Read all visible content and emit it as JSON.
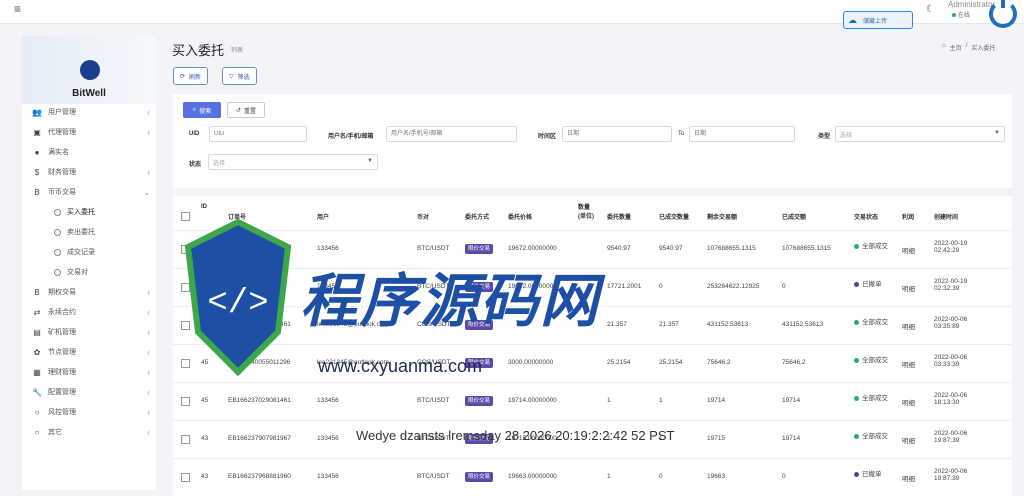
{
  "topbar": {
    "top_button_label": "储藏上传",
    "admin_name": "Administrator",
    "status_label": "在线"
  },
  "sidebar": {
    "brand": "BitWell",
    "items": [
      {
        "label": "用户管理",
        "icon": "users-icon",
        "chevron": "‹"
      },
      {
        "label": "代理管理",
        "icon": "idcard-icon",
        "chevron": "‹"
      },
      {
        "label": "满实名",
        "icon": "user-circle-icon",
        "chevron": ""
      },
      {
        "label": "财务管理",
        "icon": "dollar-icon",
        "chevron": "‹"
      },
      {
        "label": "币币交易",
        "icon": "bitcoin-icon",
        "chevron": "⌄"
      }
    ],
    "sub_items": [
      {
        "label": "买入委托"
      },
      {
        "label": "卖出委托"
      },
      {
        "label": "成交记录"
      },
      {
        "label": "交易对"
      }
    ],
    "items_after": [
      {
        "label": "期权交易",
        "icon": "bitcoin-icon",
        "chevron": "‹"
      },
      {
        "label": "永续合约",
        "icon": "swap-icon",
        "chevron": "‹"
      },
      {
        "label": "矿机管理",
        "icon": "image-icon",
        "chevron": "‹"
      },
      {
        "label": "节点管理",
        "icon": "gear-icon",
        "chevron": "‹"
      },
      {
        "label": "理财管理",
        "icon": "grid-icon",
        "chevron": "‹"
      },
      {
        "label": "配置管理",
        "icon": "wrench-icon",
        "chevron": "‹"
      },
      {
        "label": "风控管理",
        "icon": "circle-icon",
        "chevron": "‹"
      },
      {
        "label": "其它",
        "icon": "circle-icon",
        "chevron": "‹"
      }
    ]
  },
  "page": {
    "title": "买入委托",
    "subtitle": "列表",
    "breadcrumb_home": "主页",
    "breadcrumb_sep": "/",
    "breadcrumb_current": "买入委托",
    "refresh_label": "刷新",
    "filter_label": "筛选"
  },
  "filters": {
    "search_label": "搜索",
    "reset_label": "重置",
    "uid_label": "UID",
    "uid_placeholder": "UID",
    "account_label": "用户名/手机/邮箱",
    "account_placeholder": "用户名/手机号/邮箱",
    "time_label": "时间区",
    "time_start_placeholder": "日期",
    "time_to": "To",
    "time_end_placeholder": "日期",
    "type_label": "类型",
    "type_value": "选择",
    "status_label": "状态",
    "status_value": "选择"
  },
  "table": {
    "headers": [
      "ID",
      "订单号",
      "用户",
      "币对",
      "委托方式",
      "委托价格",
      "数量(单位)",
      "委托数量",
      "已成交数量",
      "剩余交易额",
      "已成交额",
      "交易状态",
      "利润",
      "创建时间"
    ],
    "rows": [
      {
        "id": "",
        "order": "EB166237...589",
        "user": "133456",
        "pair": "BTC/USDT",
        "method": "限价交易",
        "price": "19672.00000000",
        "qty": "9540.97",
        "filled": "9540.97",
        "remaining": "107688655.1315",
        "amount": "107688655.1315",
        "status": "全部成交",
        "status_color": "#2aa876",
        "profit": "明细",
        "time": "2022-00-19 02:42:29"
      },
      {
        "id": "",
        "order": "EB166237...821",
        "user": "133456",
        "pair": "BTC/USDT",
        "method": "限价交易",
        "price": "19672.00000000",
        "qty": "17721.2001",
        "filled": "0",
        "remaining": "253264622.12925",
        "amount": "0",
        "status": "已撤单",
        "status_color": "#3a4fa8",
        "profit": "明细",
        "time": "2022-00-19 02:32:39"
      },
      {
        "id": "46",
        "order": "EB166240723921461",
        "user": "lee221345@outlook.com",
        "pair": "COS/USDT",
        "method": "限价交易",
        "price": "",
        "qty": "21.357",
        "filled": "21.357",
        "remaining": "431152.53613",
        "amount": "431152.53613",
        "status": "全部成交",
        "status_color": "#2aa876",
        "profit": "明细",
        "time": "2022-00-06 03:35:89"
      },
      {
        "id": "45",
        "order": "EB166240055011296",
        "user": "lee221345@outlook.com",
        "pair": "COS/USDT",
        "method": "限价交易",
        "price": "3000.00000000",
        "qty": "25.2154",
        "filled": "25.2154",
        "remaining": "75646.2",
        "amount": "75646.2",
        "status": "全部成交",
        "status_color": "#2aa876",
        "profit": "明细",
        "time": "2022-00-06 03:33:39"
      },
      {
        "id": "45",
        "order": "EB166237029081461",
        "user": "133456",
        "pair": "BTC/USDT",
        "method": "限价交易",
        "price": "19714.00000000",
        "qty": "1",
        "filled": "1",
        "remaining": "19714",
        "amount": "19714",
        "status": "全部成交",
        "status_color": "#2aa876",
        "profit": "明细",
        "time": "2022-00-06 18:13:30"
      },
      {
        "id": "43",
        "order": "EB166237907981967",
        "user": "133456",
        "pair": "BTC/USDT",
        "method": "限价交易",
        "price": "19715.00000000",
        "qty": "1",
        "filled": "1",
        "remaining": "19715",
        "amount": "19714",
        "status": "全部成交",
        "status_color": "#2aa876",
        "profit": "明细",
        "time": "2022-00-06 19:87:39"
      },
      {
        "id": "43",
        "order": "EB166237968881960",
        "user": "133456",
        "pair": "BTC/USDT",
        "method": "限价交易",
        "price": "19663.00000000",
        "qty": "1",
        "filled": "0",
        "remaining": "19663",
        "amount": "0",
        "status": "已撤单",
        "status_color": "#3a4fa8",
        "profit": "明细",
        "time": "2022-00-06 19:87:39"
      }
    ]
  },
  "watermark": {
    "text": "程序源码网",
    "url": "www.cxyuanma.com",
    "date": "Wedye dzansts lremsday 28 2026 20:19:2:2:42 52 PST"
  },
  "colors": {
    "primary": "#5572e0",
    "accent": "#1f6fbf",
    "success": "#2aa876",
    "purple_pill": "#5b4aa8"
  }
}
